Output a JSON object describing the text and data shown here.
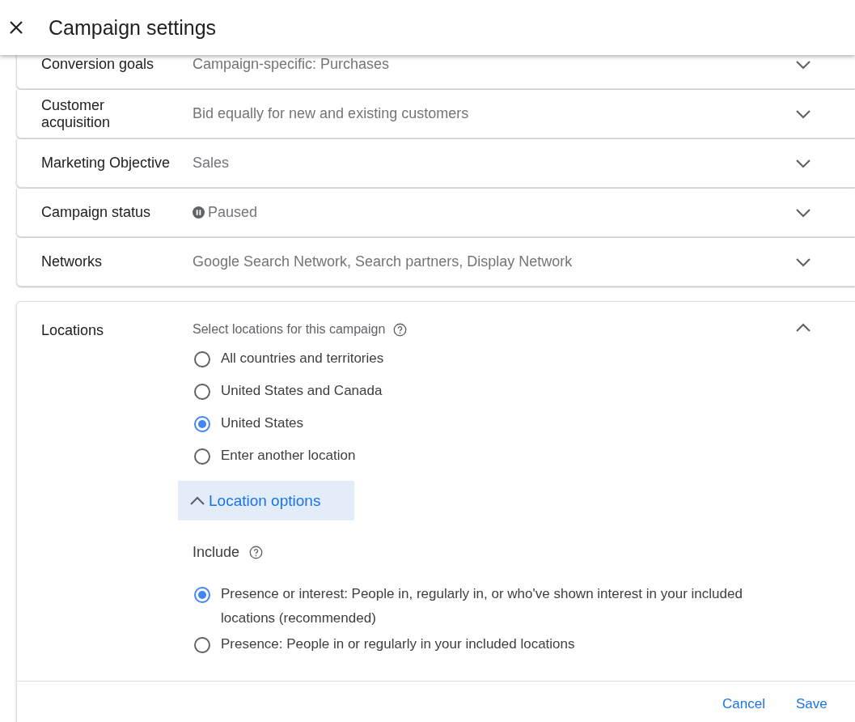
{
  "header": {
    "title": "Campaign settings"
  },
  "settings": [
    {
      "label": "Conversion goals",
      "value": "Campaign-specific: Purchases",
      "kind": "text",
      "expanded": false
    },
    {
      "label": "Customer acquisition",
      "value": "Bid equally for new and existing customers",
      "kind": "text",
      "expanded": false
    },
    {
      "label": "Marketing Objective",
      "value": "Sales",
      "kind": "text",
      "expanded": false
    },
    {
      "label": "Campaign status",
      "value": "Paused",
      "kind": "status",
      "expanded": false
    },
    {
      "label": "Networks",
      "value": "Google Search Network, Search partners, Display Network",
      "kind": "text",
      "expanded": false
    }
  ],
  "locations": {
    "label": "Locations",
    "prompt": "Select locations for this campaign",
    "expanded": true,
    "options": [
      {
        "label": "All countries and territories",
        "selected": false
      },
      {
        "label": "United States and Canada",
        "selected": false
      },
      {
        "label": "United States",
        "selected": true
      },
      {
        "label": "Enter another location",
        "selected": false
      }
    ],
    "location_options": {
      "label": "Location options",
      "expanded": true
    },
    "include": {
      "label": "Include",
      "options": [
        {
          "label": "Presence or interest: People in, regularly in, or who've shown interest in your included locations (recommended)",
          "selected": true
        },
        {
          "label": "Presence: People in or regularly in your included locations",
          "selected": false
        }
      ]
    }
  },
  "actions": [
    {
      "label": "Cancel"
    },
    {
      "label": "Save"
    }
  ]
}
